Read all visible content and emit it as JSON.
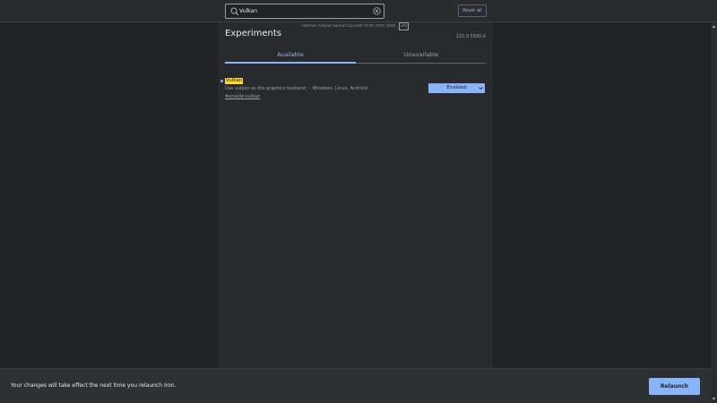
{
  "colors": {
    "accent": "#8ab4f8",
    "page_background": "#202124",
    "panel_background": "#292a2d",
    "highlight": "#fdd835"
  },
  "toolbar": {
    "search_value": "Vulkan",
    "search_icon": "search-icon",
    "clear_icon": "close-circle-icon",
    "reset_label": "Reset all"
  },
  "header": {
    "warning": "חסלב חלדב תרלת חסיוהבברחבבשת חבשתהי חבתחגת",
    "warning_box": "פלג",
    "title": "Experiments",
    "version": "110.0.5500.0"
  },
  "tabs": [
    {
      "label": "Available",
      "selected": true
    },
    {
      "label": "Unavailable",
      "selected": false
    }
  ],
  "experiment": {
    "name": "Vulkan",
    "description": "Use vulkan as the graphics backend. – Windows, Linux, Android",
    "link": "#enable-vulkan",
    "selected_option": "Enabled",
    "chevron_icon": "chevron-down-icon"
  },
  "footer": {
    "message": "Your changes will take effect the next time you relaunch Iron.",
    "relaunch_label": "Relaunch"
  }
}
